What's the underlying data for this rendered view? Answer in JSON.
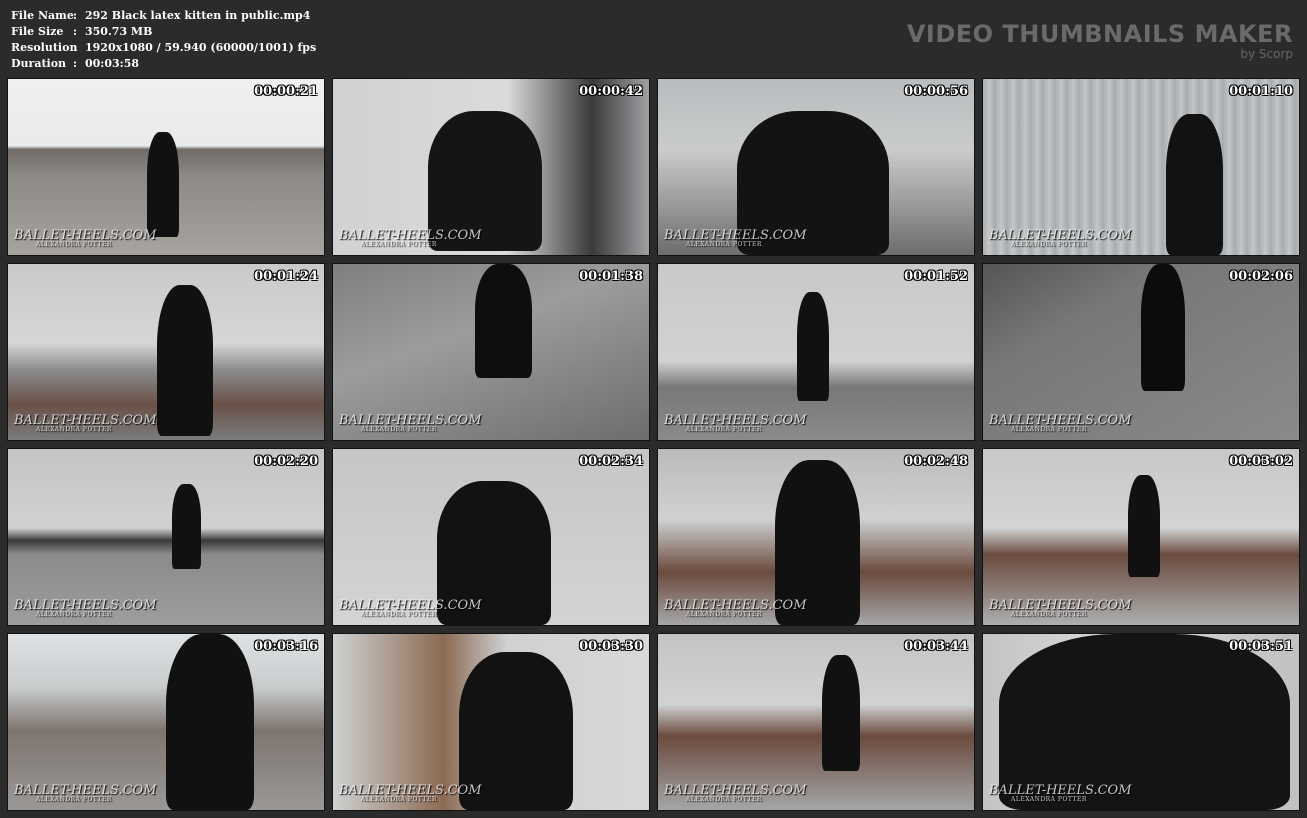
{
  "info": {
    "rows": [
      {
        "key": "File Name",
        "value": "292 Black latex kitten in public.mp4"
      },
      {
        "key": "File Size",
        "value": "350.73 MB"
      },
      {
        "key": "Resolution",
        "value": "1920x1080 / 59.940 (60000/1001) fps"
      },
      {
        "key": "Duration",
        "value": "00:03:58"
      }
    ],
    "separator": ":"
  },
  "brand": {
    "title": "VIDEO THUMBNAILS MAKER",
    "byline": "by Scorp"
  },
  "watermark": {
    "line1": "BALLET-HEELS.COM",
    "line2": "ALEXANDRA POTTER"
  },
  "thumbnails": [
    {
      "time": "00:00:21"
    },
    {
      "time": "00:00:42"
    },
    {
      "time": "00:00:56"
    },
    {
      "time": "00:01:10"
    },
    {
      "time": "00:01:24"
    },
    {
      "time": "00:01:38"
    },
    {
      "time": "00:01:52"
    },
    {
      "time": "00:02:06"
    },
    {
      "time": "00:02:20"
    },
    {
      "time": "00:02:34"
    },
    {
      "time": "00:02:48"
    },
    {
      "time": "00:03:02"
    },
    {
      "time": "00:03:16"
    },
    {
      "time": "00:03:30"
    },
    {
      "time": "00:03:44"
    },
    {
      "time": "00:03:51"
    }
  ],
  "colors": {
    "background": "#2b2b2b",
    "brand": "#6a6a6a",
    "text": "#ffffff"
  }
}
